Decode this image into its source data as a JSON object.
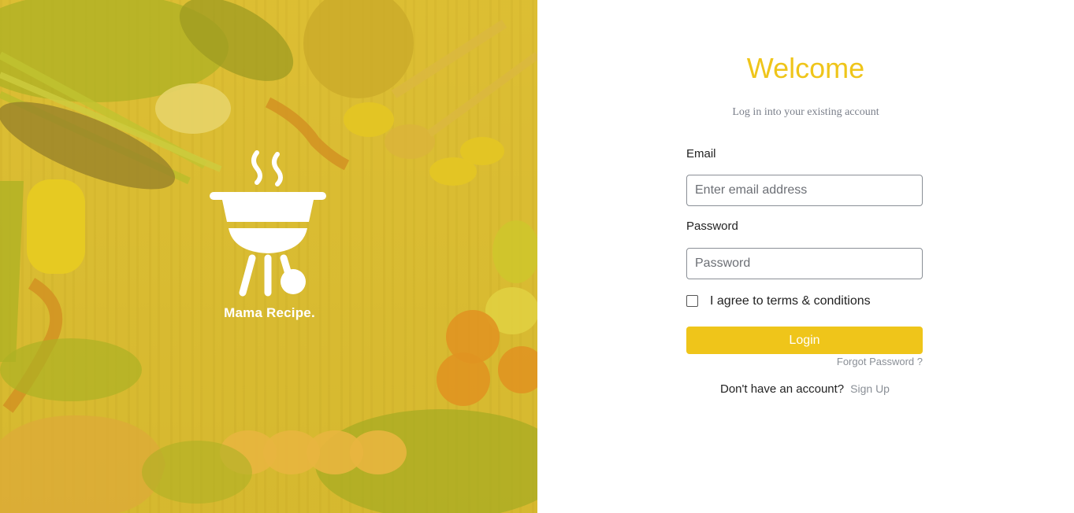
{
  "brand": {
    "name": "Mama Recipe."
  },
  "form": {
    "title": "Welcome",
    "subtitle": "Log in into your existing account",
    "email_label": "Email",
    "email_placeholder": "Enter email address",
    "password_label": "Password",
    "password_placeholder": "Password",
    "terms_label": "I agree to terms & conditions",
    "login_label": "Login",
    "forgot_label": "Forgot Password ?",
    "signup_prompt": "Don't have an account?",
    "signup_label": "Sign Up"
  },
  "colors": {
    "accent": "#efc51a",
    "overlay": "#e0c428",
    "muted": "#8a8f96"
  },
  "icons": {
    "logo": "barbecue-grill-icon"
  }
}
